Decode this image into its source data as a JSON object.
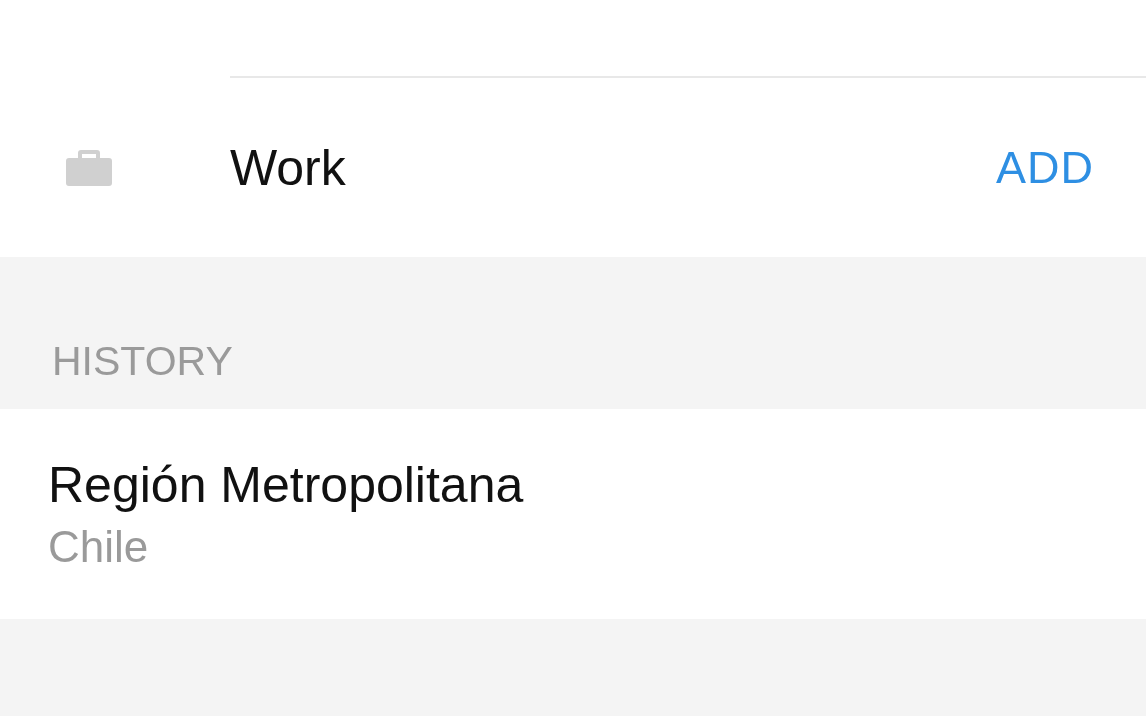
{
  "saved_places": [
    {
      "kind": "work",
      "label": "Work",
      "action": "ADD"
    }
  ],
  "history": {
    "heading": "HISTORY",
    "items": [
      {
        "title": "Región Metropolitana",
        "subtitle": "Chile"
      }
    ]
  }
}
